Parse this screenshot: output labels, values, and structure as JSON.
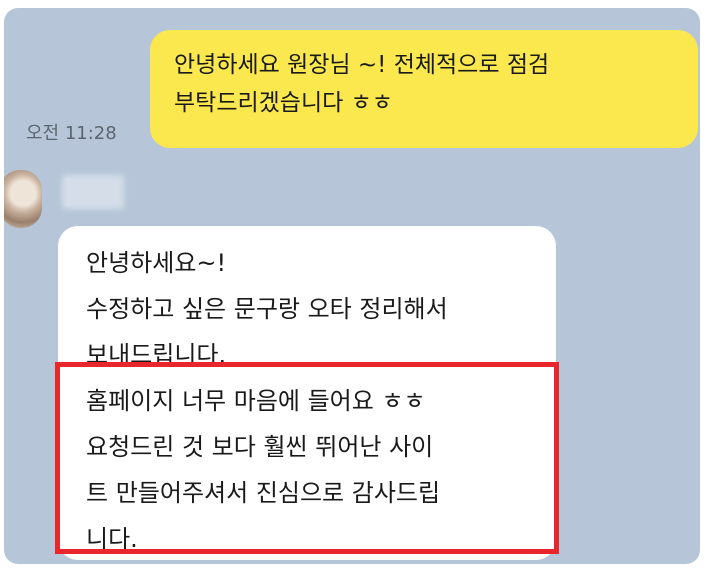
{
  "outgoing_message": {
    "lines": [
      "안녕하세요 원장님 ~! 전체적으로 점검",
      "부탁드리겠습니다 ㅎㅎ"
    ],
    "time": "오전 11:28",
    "bubble_color": "#fae84e"
  },
  "incoming_message": {
    "lines": [
      "안녕하세요~!",
      "수정하고 싶은 문구랑 오타 정리해서",
      "보내드립니다.",
      "홈페이지 너무 마음에 들어요 ㅎㅎ",
      "요청드린 것 보다 훨씬 뛰어난 사이",
      "트 만들어주셔서 진심으로 감사드립",
      "니다."
    ],
    "bubble_color": "#ffffff"
  },
  "highlight_color": "#e8262b",
  "chat_background": "#b6c6d8"
}
